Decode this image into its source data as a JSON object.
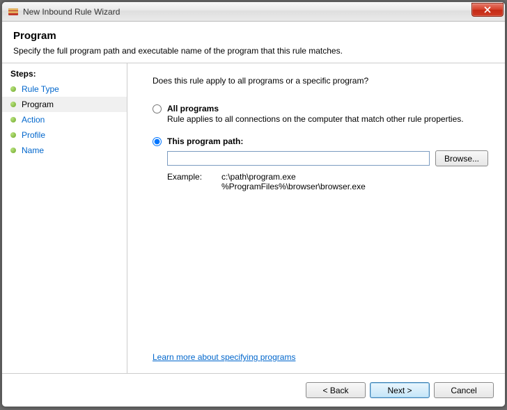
{
  "window": {
    "title": "New Inbound Rule Wizard"
  },
  "header": {
    "title": "Program",
    "subtitle": "Specify the full program path and executable name of the program that this rule matches."
  },
  "sidebar": {
    "label": "Steps:",
    "items": [
      {
        "label": "Rule Type"
      },
      {
        "label": "Program"
      },
      {
        "label": "Action"
      },
      {
        "label": "Profile"
      },
      {
        "label": "Name"
      }
    ],
    "current_index": 1
  },
  "main": {
    "question": "Does this rule apply to all programs or a specific program?",
    "option_all": {
      "title": "All programs",
      "desc": "Rule applies to all connections on the computer that match other rule properties."
    },
    "option_path": {
      "title": "This program path:",
      "value": "",
      "browse_label": "Browse...",
      "example_label": "Example:",
      "example_line1": "c:\\path\\program.exe",
      "example_line2": "%ProgramFiles%\\browser\\browser.exe"
    },
    "selected": "path",
    "learn_more": "Learn more about specifying programs"
  },
  "footer": {
    "back": "< Back",
    "next": "Next >",
    "cancel": "Cancel"
  }
}
